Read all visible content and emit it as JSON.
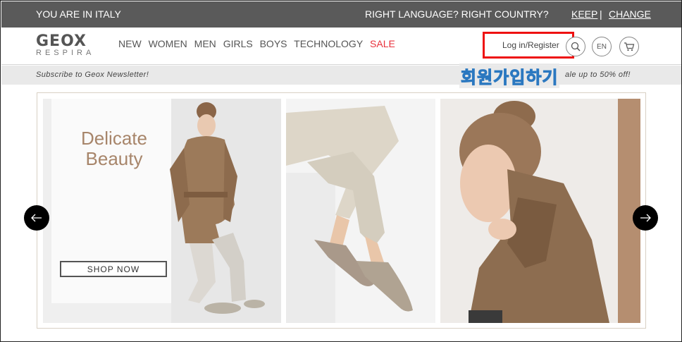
{
  "topbar": {
    "country_text": "YOU ARE IN ITALY",
    "question_text": "RIGHT LANGUAGE?  RIGHT COUNTRY?",
    "keep_label": "KEEP",
    "separator": "|",
    "change_label": "CHANGE"
  },
  "header": {
    "logo_main": "GEOX",
    "logo_sub": "RESPIRA",
    "nav": [
      "NEW",
      "WOMEN",
      "MEN",
      "GIRLS",
      "BOYS",
      "TECHNOLOGY",
      "SALE"
    ],
    "login_label": "Log in/Register",
    "language_label": "EN",
    "search_icon": "search-icon",
    "cart_icon": "cart-icon"
  },
  "strip": {
    "newsletter_text": "Subscribe to Geox Newsletter!",
    "promo_text": "ale up to 50% off!"
  },
  "annotation": {
    "korean_label": "회원가입하기",
    "highlight_color": "#ee1111",
    "label_color": "#2b78c0"
  },
  "carousel": {
    "headline_line1": "Delicate",
    "headline_line2": "Beauty",
    "cta_label": "SHOP NOW",
    "prev_icon": "arrow-left-icon",
    "next_icon": "arrow-right-icon"
  },
  "colors": {
    "topbar_bg": "#5a5a5a",
    "sale": "#e8323c",
    "headline": "#a7856a"
  }
}
